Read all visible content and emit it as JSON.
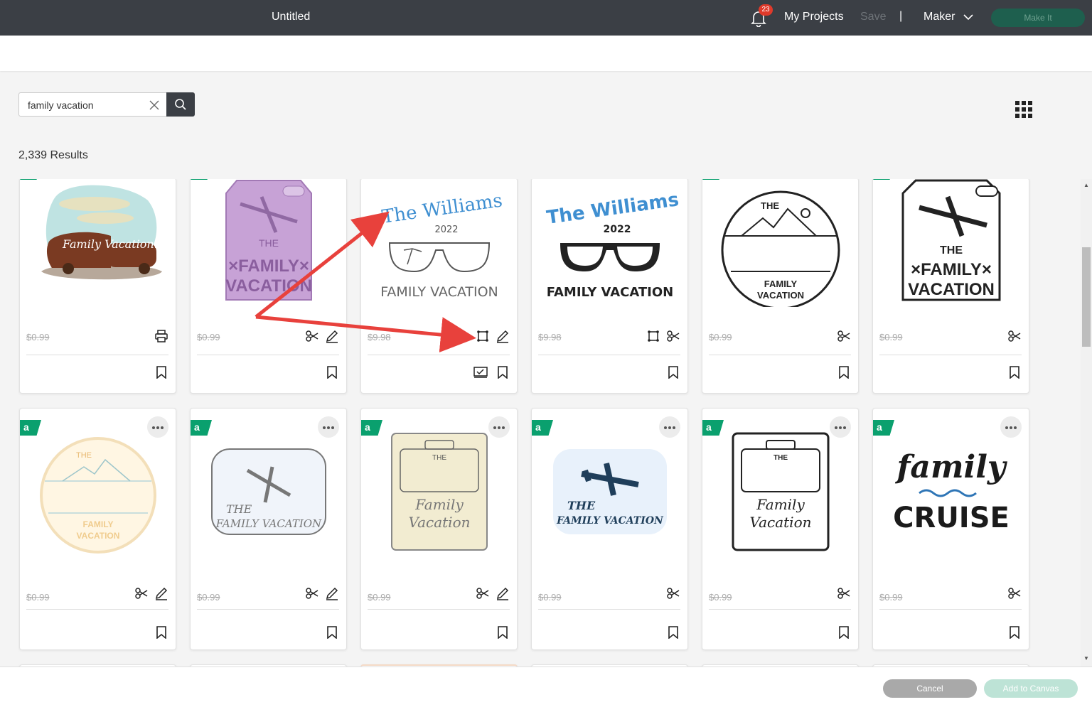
{
  "header": {
    "title": "Untitled",
    "notifications_count": "23",
    "my_projects": "My Projects",
    "save": "Save",
    "separator": "|",
    "machine": "Maker",
    "make_it": "Make It"
  },
  "search": {
    "value": "family vacation"
  },
  "results_count": "2,339 Results",
  "cards_row1": [
    {
      "price": "$0.99",
      "art": "Family Vacation!"
    },
    {
      "price": "$0.99",
      "art_lines": [
        "THE",
        "×FAMILY×",
        "VACATION"
      ]
    },
    {
      "price": "$9.98",
      "art_lines": [
        "The Williams",
        "2022",
        "FAMILY VACATION"
      ]
    },
    {
      "price": "$9.98",
      "art_lines": [
        "The Williams",
        "2022",
        "FAMILY VACATION"
      ]
    },
    {
      "price": "$0.99",
      "art_lines": [
        "THE",
        "FAMILY",
        "VACATION"
      ]
    },
    {
      "price": "$0.99",
      "art_lines": [
        "THE",
        "×FAMILY×",
        "VACATION"
      ]
    }
  ],
  "cards_row2": [
    {
      "price": "$0.99",
      "tag": "a",
      "art_lines": [
        "THE",
        "FAMILY",
        "VACATION"
      ]
    },
    {
      "price": "$0.99",
      "tag": "a",
      "art_lines": [
        "THE",
        "FAMILY VACATION"
      ]
    },
    {
      "price": "$0.99",
      "tag": "a",
      "art_lines": [
        "THE",
        "Family",
        "Vacation"
      ]
    },
    {
      "price": "$0.99",
      "tag": "a",
      "art_lines": [
        "THE",
        "FAMILY VACATION"
      ]
    },
    {
      "price": "$0.99",
      "tag": "a",
      "art_lines": [
        "THE",
        "Family",
        "Vacation"
      ]
    },
    {
      "price": "$0.99",
      "tag": "a",
      "art_lines": [
        "family",
        "CRUISE"
      ]
    }
  ],
  "footer": {
    "cancel": "Cancel",
    "add_to_canvas": "Add to Canvas"
  },
  "colors": {
    "topbar": "#3b3f45",
    "accent_green": "#0aa06e",
    "make_it": "#1e5f4e",
    "annotation_arrow": "#e8413c"
  }
}
